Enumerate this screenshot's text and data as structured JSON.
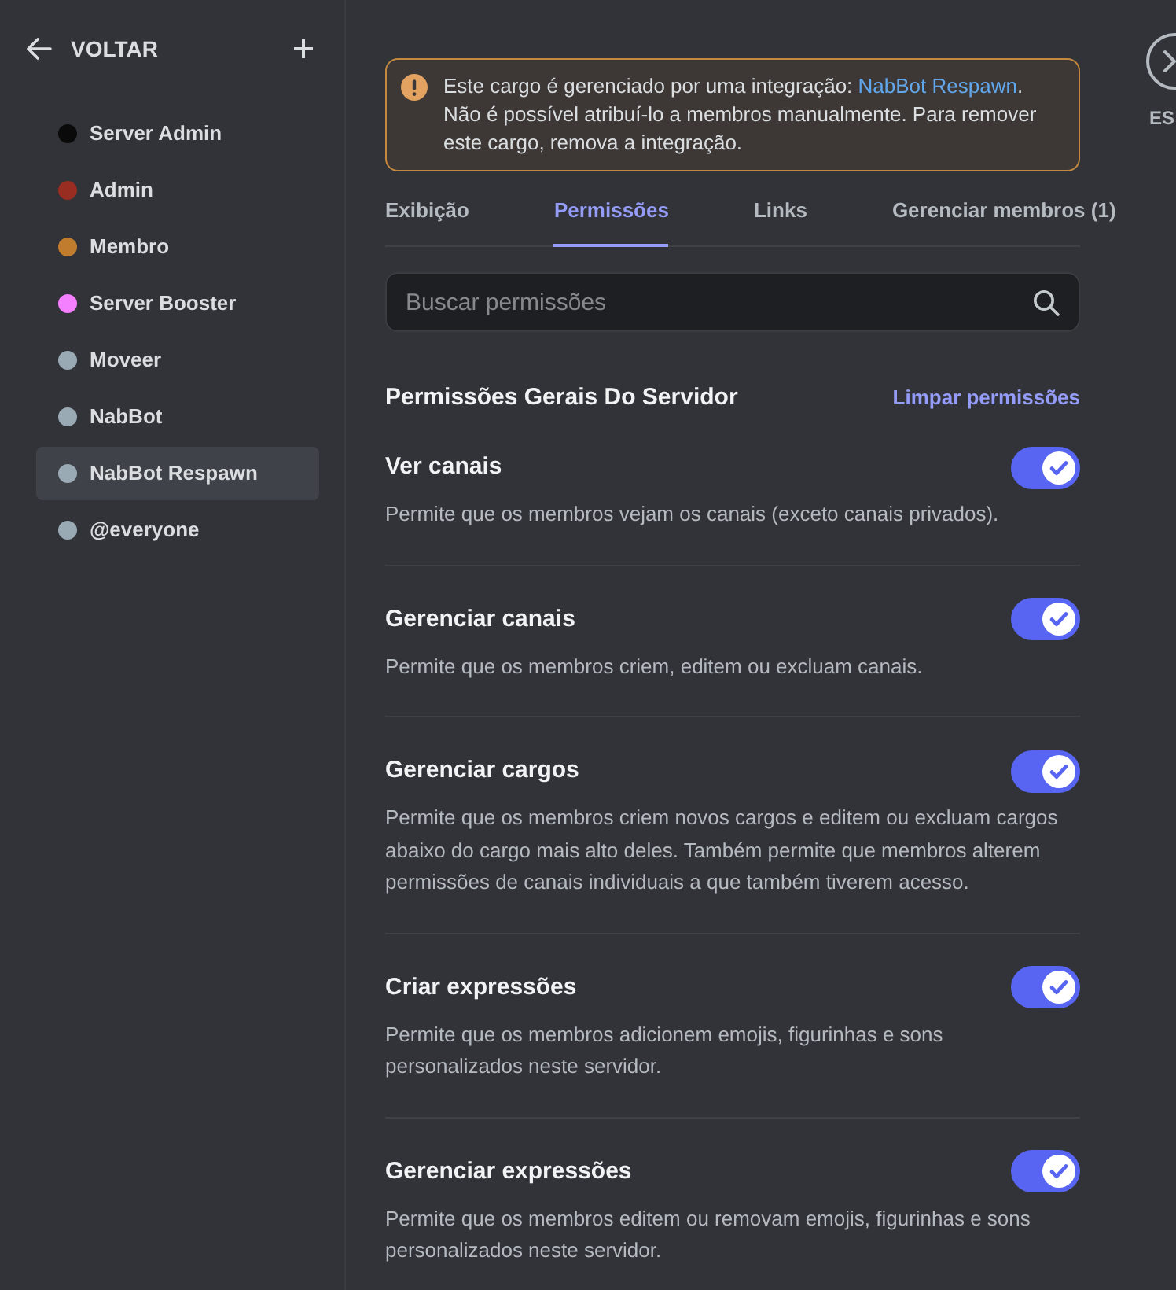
{
  "sidebar": {
    "back_label": "VOLTAR",
    "roles": [
      {
        "name": "Server Admin",
        "color": "#0a0a0a",
        "selected": false
      },
      {
        "name": "Admin",
        "color": "#992d22",
        "selected": false
      },
      {
        "name": "Membro",
        "color": "#c27c2e",
        "selected": false
      },
      {
        "name": "Server Booster",
        "color": "#f47fff",
        "selected": false
      },
      {
        "name": "Moveer",
        "color": "#99aab5",
        "selected": false
      },
      {
        "name": "NabBot",
        "color": "#99aab5",
        "selected": false
      },
      {
        "name": "NabBot Respawn",
        "color": "#99aab5",
        "selected": true
      },
      {
        "name": "@everyone",
        "color": "#99aab5",
        "selected": false
      }
    ]
  },
  "header": {
    "close_label": "ES"
  },
  "alert": {
    "text_before": "Este cargo é gerenciado por uma integração: ",
    "link": "NabBot Respawn",
    "text_after": ". Não é possível atribuí-lo a membros manualmente. Para remover este cargo, remova a integração."
  },
  "tabs": [
    {
      "label": "Exibição",
      "selected": false
    },
    {
      "label": "Permissões",
      "selected": true
    },
    {
      "label": "Links",
      "selected": false
    },
    {
      "label": "Gerenciar membros (1)",
      "selected": false
    }
  ],
  "search": {
    "placeholder": "Buscar permissões"
  },
  "section": {
    "title": "Permissões Gerais Do Servidor",
    "clear_label": "Limpar permissões"
  },
  "permissions": [
    {
      "name": "Ver canais",
      "description": "Permite que os membros vejam os canais (exceto canais privados).",
      "enabled": true
    },
    {
      "name": "Gerenciar canais",
      "description": "Permite que os membros criem, editem ou excluam canais.",
      "enabled": true
    },
    {
      "name": "Gerenciar cargos",
      "description": "Permite que os membros criem novos cargos e editem ou excluam cargos abaixo do cargo mais alto deles. Também permite que membros alterem permissões de canais individuais a que também tiverem acesso.",
      "enabled": true
    },
    {
      "name": "Criar expressões",
      "description": "Permite que os membros adicionem emojis, figurinhas e sons personalizados neste servidor.",
      "enabled": true
    },
    {
      "name": "Gerenciar expressões",
      "description": "Permite que os membros editem ou removam emojis, figurinhas e sons personalizados neste servidor.",
      "enabled": true
    }
  ]
}
